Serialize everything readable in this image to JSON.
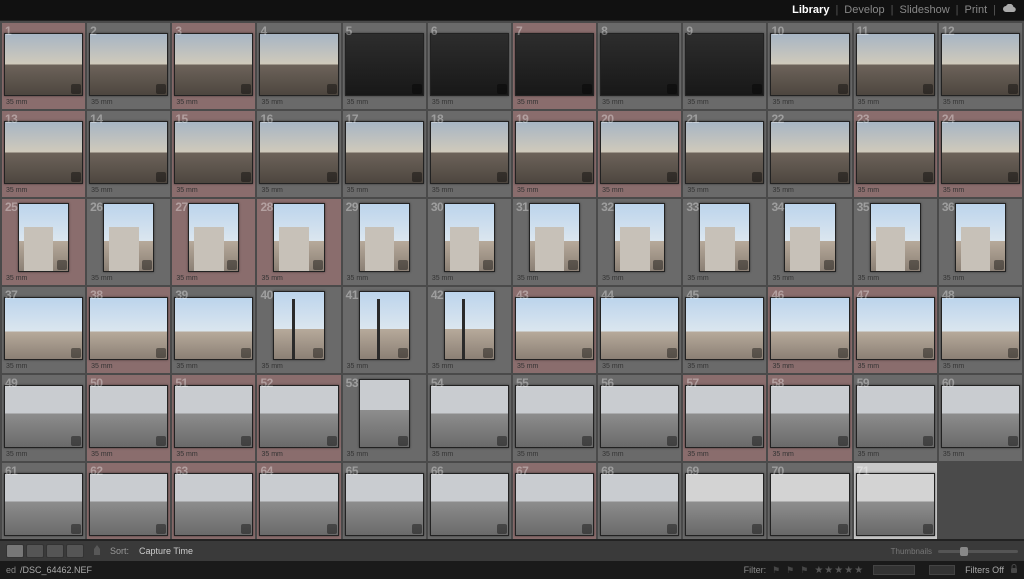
{
  "modules": {
    "items": [
      "Library",
      "Develop",
      "Slideshow",
      "Print"
    ],
    "active": "Library"
  },
  "grid": {
    "columns": 12,
    "count": 71,
    "focal_label": "35 mm",
    "flagged_indices": [
      1,
      3,
      7,
      13,
      15,
      19,
      20,
      23,
      24,
      25,
      27,
      28,
      38,
      43,
      46,
      47,
      50,
      51,
      52,
      57,
      58,
      62,
      63,
      64,
      67
    ],
    "selected_index": 71,
    "portrait_indices": [
      25,
      26,
      27,
      28,
      29,
      30,
      31,
      32,
      33,
      34,
      35,
      36,
      40,
      41,
      42,
      53
    ]
  },
  "toolbar": {
    "sort_label": "Sort:",
    "sort_field": "Capture Time",
    "thumbnails_label": "Thumbnails"
  },
  "status": {
    "filename_prefix": "ed",
    "filename": "/DSC_64462.NEF",
    "filter_label": "Filter:",
    "filters_off": "Filters Off"
  }
}
